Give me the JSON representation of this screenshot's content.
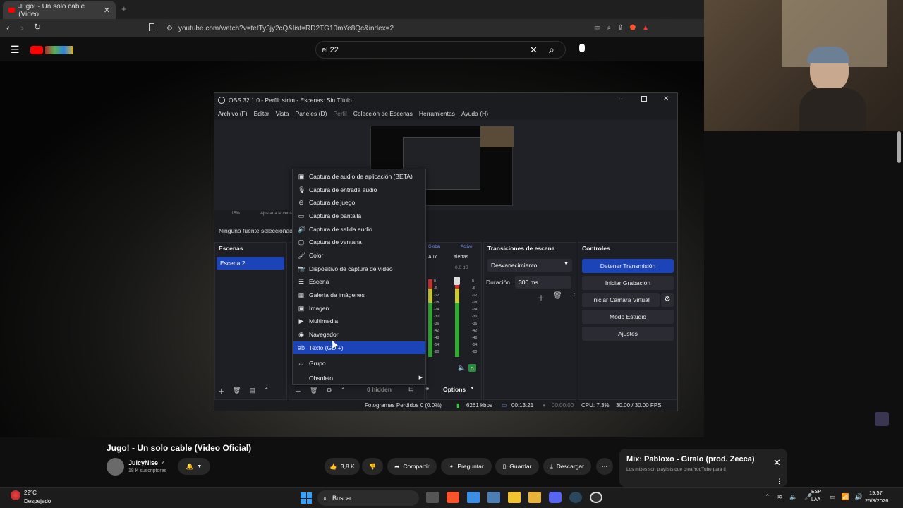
{
  "browser": {
    "tab_title": "Jugo! - Un solo cable (Video",
    "url": "youtube.com/watch?v=tetTy3jy2cQ&list=RD2TG10mYe8Qc&index=2",
    "new_tab": "+"
  },
  "youtube": {
    "search_value": "el 22",
    "video_title": "Jugo! - Un solo cable (Video Oficial)",
    "channel": "JuicyNlse",
    "subscribers": "18 K suscriptores",
    "likes": "3,8 K",
    "share": "Compartir",
    "ask": "Preguntar",
    "save": "Guardar",
    "download": "Descargar",
    "mix_title": "Mix: Pabloxo - Giralo (prod. Zecca)",
    "mix_sub": "Los mixes son playlists que crea YouTube para ti"
  },
  "obs": {
    "title": "OBS 32.1.0 - Perfil: strim - Escenas: Sin Título",
    "menu": [
      "Archivo (F)",
      "Editar",
      "Vista",
      "Paneles (D)",
      "Perfil",
      "Colección de Escenas",
      "Herramientas",
      "Ayuda (H)"
    ],
    "zoom": "15%",
    "fit": "Ajustar a la ventana",
    "no_source": "Ninguna fuente seleccionada",
    "scenes_header": "Escenas",
    "scene_selected": "Escena 2",
    "mixer_global": "Global",
    "mixer_active": "Active",
    "mixer_aux": "Aux",
    "mixer_alerts": "alertas",
    "mixer_db": "0.0 dB",
    "mixer_scale": [
      "0",
      "-6",
      "-12",
      "-18",
      "-24",
      "-30",
      "-36",
      "-42",
      "-48",
      "-54",
      "-60"
    ],
    "hidden": "0 hidden",
    "options": "Options",
    "transitions_header": "Transiciones de escena",
    "transition_value": "Desvanecimiento",
    "duration_label": "Duración",
    "duration_value": "300 ms",
    "controls_header": "Controles",
    "controls": [
      "Detener Transmisión",
      "Iniciar Grabación",
      "Iniciar Cámara Virtual",
      "Modo Estudio",
      "Ajustes"
    ],
    "status": {
      "dropped": "Fotogramas Perdidos 0 (0.0%)",
      "kbps": "6261 kbps",
      "stream_time": "00:13:21",
      "rec_time": "00:00:00",
      "cpu": "CPU: 7.3%",
      "fps": "30.00 / 30.00 FPS"
    }
  },
  "context_menu": [
    {
      "label": "Captura de audio de aplicación (BETA)",
      "icon": "app-audio-icon"
    },
    {
      "label": "Captura de entrada audio",
      "icon": "mic-icon"
    },
    {
      "label": "Captura de juego",
      "icon": "gamepad-icon"
    },
    {
      "label": "Captura de pantalla",
      "icon": "monitor-icon"
    },
    {
      "label": "Captura de salida audio",
      "icon": "speaker-icon"
    },
    {
      "label": "Captura de ventana",
      "icon": "window-icon"
    },
    {
      "label": "Color",
      "icon": "brush-icon"
    },
    {
      "label": "Dispositivo de captura de vídeo",
      "icon": "camera-icon"
    },
    {
      "label": "Escena",
      "icon": "list-icon"
    },
    {
      "label": "Galería de imágenes",
      "icon": "gallery-icon"
    },
    {
      "label": "Imagen",
      "icon": "image-icon"
    },
    {
      "label": "Multimedia",
      "icon": "play-icon"
    },
    {
      "label": "Navegador",
      "icon": "globe-icon"
    },
    {
      "label": "Texto (GDI+)",
      "icon": "text-icon"
    },
    {
      "label": "Grupo",
      "icon": "folder-icon"
    },
    {
      "label": "Obsoleto",
      "icon": "chevron-right-icon"
    }
  ],
  "taskbar": {
    "temp": "22°C",
    "weather": "Despejado",
    "search": "Buscar",
    "lang1": "ESP",
    "lang2": "LAA",
    "time": "19:57",
    "date": "25/3/2026"
  },
  "colors": {
    "accent": "#1c44b9",
    "youtube_red": "#ff0000",
    "obs_bg": "#1b1c20"
  }
}
